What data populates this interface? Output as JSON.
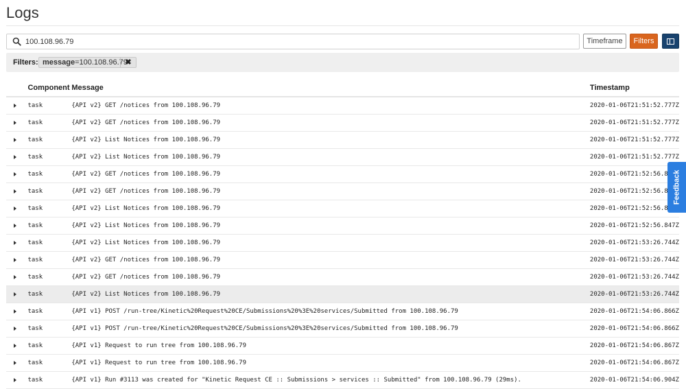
{
  "page": {
    "title": "Logs"
  },
  "search": {
    "value": "100.108.96.79",
    "placeholder": ""
  },
  "toolbar": {
    "timeframe_label": "Timeframe",
    "filters_label": "Filters",
    "columns_icon": "columns-icon"
  },
  "filters": {
    "label": "Filters:",
    "chips": [
      {
        "key": "message",
        "value": "=100.108.96.79"
      }
    ]
  },
  "table": {
    "headers": {
      "component": "Component",
      "message": "Message",
      "timestamp": "Timestamp"
    },
    "rows": [
      {
        "component": "task",
        "message": "{API v2} GET /notices from 100.108.96.79",
        "timestamp": "2020-01-06T21:51:52.777Z"
      },
      {
        "component": "task",
        "message": "{API v2} GET /notices from 100.108.96.79",
        "timestamp": "2020-01-06T21:51:52.777Z"
      },
      {
        "component": "task",
        "message": "{API v2} List Notices from 100.108.96.79",
        "timestamp": "2020-01-06T21:51:52.777Z"
      },
      {
        "component": "task",
        "message": "{API v2} List Notices from 100.108.96.79",
        "timestamp": "2020-01-06T21:51:52.777Z"
      },
      {
        "component": "task",
        "message": "{API v2} GET /notices from 100.108.96.79",
        "timestamp": "2020-01-06T21:52:56.8"
      },
      {
        "component": "task",
        "message": "{API v2} GET /notices from 100.108.96.79",
        "timestamp": "2020-01-06T21:52:56.8"
      },
      {
        "component": "task",
        "message": "{API v2} List Notices from 100.108.96.79",
        "timestamp": "2020-01-06T21:52:56.8"
      },
      {
        "component": "task",
        "message": "{API v2} List Notices from 100.108.96.79",
        "timestamp": "2020-01-06T21:52:56.847Z"
      },
      {
        "component": "task",
        "message": "{API v2} List Notices from 100.108.96.79",
        "timestamp": "2020-01-06T21:53:26.744Z"
      },
      {
        "component": "task",
        "message": "{API v2} GET /notices from 100.108.96.79",
        "timestamp": "2020-01-06T21:53:26.744Z"
      },
      {
        "component": "task",
        "message": "{API v2} GET /notices from 100.108.96.79",
        "timestamp": "2020-01-06T21:53:26.744Z"
      },
      {
        "component": "task",
        "message": "{API v2} List Notices from 100.108.96.79",
        "timestamp": "2020-01-06T21:53:26.744Z"
      },
      {
        "component": "task",
        "message": "{API v1} POST /run-tree/Kinetic%20Request%20CE/Submissions%20%3E%20services/Submitted from 100.108.96.79",
        "timestamp": "2020-01-06T21:54:06.866Z"
      },
      {
        "component": "task",
        "message": "{API v1} POST /run-tree/Kinetic%20Request%20CE/Submissions%20%3E%20services/Submitted from 100.108.96.79",
        "timestamp": "2020-01-06T21:54:06.866Z"
      },
      {
        "component": "task",
        "message": "{API v1} Request to run tree from 100.108.96.79",
        "timestamp": "2020-01-06T21:54:06.867Z"
      },
      {
        "component": "task",
        "message": "{API v1} Request to run tree from 100.108.96.79",
        "timestamp": "2020-01-06T21:54:06.867Z"
      },
      {
        "component": "task",
        "message": "{API v1} Run #3113 was created for \"Kinetic Request CE :: Submissions > services :: Submitted\" from 100.108.96.79 (29ms).",
        "timestamp": "2020-01-06T21:54:06.904Z"
      }
    ],
    "highlighted_row": 11
  },
  "feedback": {
    "label": "Feedback"
  },
  "colors": {
    "filters_button": "#d9651e",
    "columns_button": "#18426e",
    "feedback_tab": "#2b7ee0",
    "filters_bar": "#efefef",
    "row_highlight": "#ececec"
  }
}
